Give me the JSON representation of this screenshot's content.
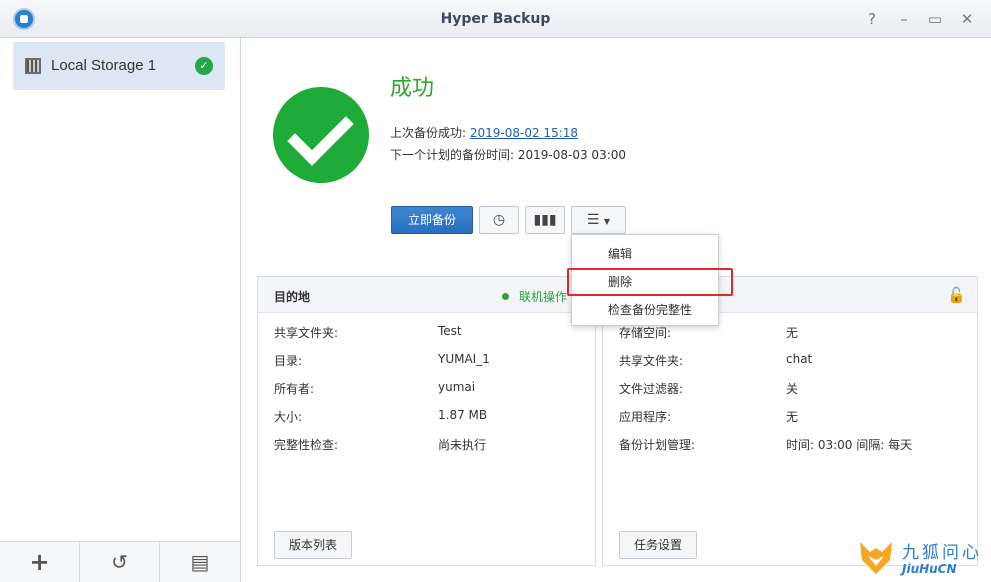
{
  "window": {
    "title": "Hyper Backup",
    "help_icon": "help-icon",
    "minimize_icon": "minimize-icon",
    "maximize_icon": "maximize-icon",
    "close_icon": "close-icon"
  },
  "sidebar": {
    "tasks": [
      {
        "label": "Local Storage 1",
        "status": "success"
      }
    ],
    "bottom_buttons": [
      "add-icon",
      "restore-icon",
      "log-icon"
    ]
  },
  "status": {
    "title": "成功",
    "last_backup_label": "上次备份成功:",
    "last_backup_value": "2019-08-02 15:18",
    "next_backup_label": "下一个计划的备份时间:",
    "next_backup_value": "2019-08-03 03:00"
  },
  "toolbar": {
    "backup_now": "立即备份"
  },
  "dropdown": {
    "items": [
      "编辑",
      "删除",
      "检查备份完整性"
    ],
    "highlighted_index": 1
  },
  "destination": {
    "title": "目的地",
    "online_status": "联机操作",
    "rows": [
      {
        "key": "共享文件夹:",
        "value": "Test"
      },
      {
        "key": "目录:",
        "value": "YUMAI_1"
      },
      {
        "key": "所有者:",
        "value": "yumai"
      },
      {
        "key": "大小:",
        "value": "1.87 MB"
      },
      {
        "key": "完整性检查:",
        "value": "尚未执行"
      }
    ],
    "button": "版本列表"
  },
  "source": {
    "rows": [
      {
        "key": "存储空间:",
        "value": "无"
      },
      {
        "key": "共享文件夹:",
        "value": "chat"
      },
      {
        "key": "文件过滤器:",
        "value": "关"
      },
      {
        "key": "应用程序:",
        "value": "无"
      },
      {
        "key": "备份计划管理:",
        "value": "时间: 03:00 间隔: 每天"
      }
    ],
    "button": "任务设置"
  },
  "watermark": {
    "cn": "九狐问心",
    "en": "JiuHuCN"
  },
  "colors": {
    "success_green": "#1eab38",
    "primary_blue": "#2a6ebf",
    "highlight_red": "#e0282e"
  }
}
